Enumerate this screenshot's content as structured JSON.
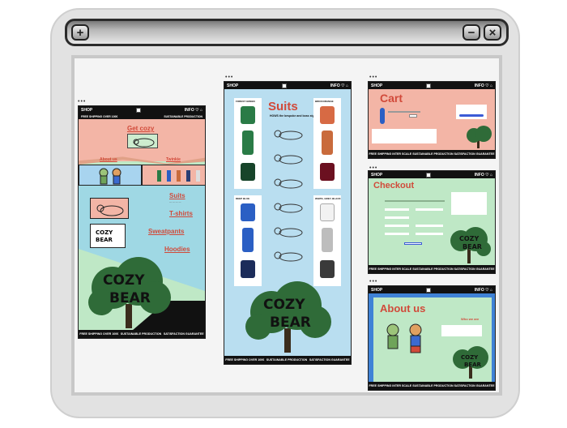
{
  "pages": {
    "home": {
      "nav": {
        "shop": "SHOP",
        "info": "INFO"
      },
      "promo_left": "FREE SHIPPING OVER 100€",
      "promo_right": "SUSTAINABLE PRODUCTION",
      "hero": "Get cozy",
      "about": "About us",
      "twins": "Twinkie",
      "sections": [
        "Suits",
        "T-shirts",
        "Sweatpants",
        "Hoodies"
      ],
      "brand": "COZY BEAR",
      "footer": [
        "FREE SHIPPING OVER 100€",
        "SUSTAINABLE PRODUCTION",
        "SATISFACTION GUARANTEE"
      ]
    },
    "suits": {
      "nav": {
        "shop": "SHOP",
        "info": "INFO"
      },
      "title": "Suits",
      "subtitle": "HOWS the bespoke and boss stylist",
      "groups": [
        "FOREST GREEN",
        "BRICKORANGE",
        "DEEP BLUE",
        "WHITE, GREY, BLACK"
      ],
      "brand": "COZY BEAR",
      "footer": [
        "FREE SHIPPING OVER 100€",
        "SUSTAINABLE PRODUCTION",
        "SATISFACTION GUARANTEE"
      ]
    },
    "cart": {
      "nav": {
        "shop": "SHOP",
        "info": "INFO"
      },
      "title": "Cart",
      "brand": "COZY BEAR",
      "footer": [
        "FREE SHIPPING INTER SCALE",
        "SUSTAINABLE PRODUCTION",
        "SATISFACTION GUARANTEE"
      ]
    },
    "checkout": {
      "nav": {
        "shop": "SHOP",
        "info": "INFO"
      },
      "title": "Checkout",
      "brand": "COZY BEAR",
      "footer": [
        "FREE SHIPPING INTER SCALE",
        "SUSTAINABLE PRODUCTION",
        "SATISFACTION GUARANTEE"
      ]
    },
    "about": {
      "nav": {
        "shop": "SHOP",
        "info": "INFO"
      },
      "title": "About us",
      "who": "Who we are",
      "brand": "COZY BEAR",
      "footer": [
        "FREE SHIPPING INTER SCALE",
        "SUSTAINABLE PRODUCTION",
        "SATISFACTION GUARANTEE"
      ]
    }
  },
  "colors": {
    "salmon": "#f3b5a6",
    "mint": "#bfe8c6",
    "sky": "#b9def0",
    "red": "#d14a3a",
    "tree": "#2f6b38"
  },
  "icons": [
    "plus-icon",
    "minimize-icon",
    "close-icon",
    "heart-icon",
    "cart-icon"
  ]
}
